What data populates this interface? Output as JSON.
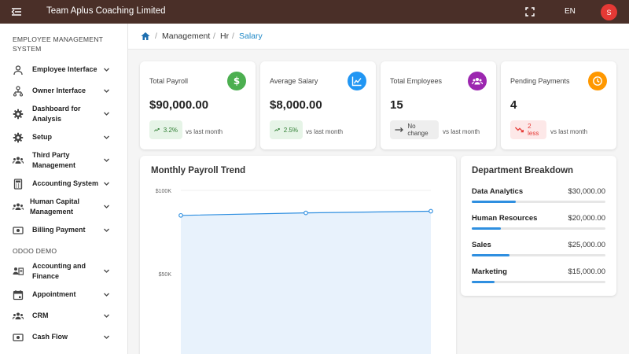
{
  "app": {
    "title": "Team Aplus Coaching Limited",
    "language": "EN",
    "avatar_initial": "S"
  },
  "sidebar": {
    "sections": [
      {
        "title": "EMPLOYEE MANAGEMENT SYSTEM",
        "items": [
          {
            "label": "Employee Interface",
            "icon": "person-icon"
          },
          {
            "label": "Owner Interface",
            "icon": "org-tree-icon"
          },
          {
            "label": "Dashboard for Analysis",
            "icon": "gear-icon"
          },
          {
            "label": "Setup",
            "icon": "gear-icon"
          },
          {
            "label": "Third Party Management",
            "icon": "group-icon"
          },
          {
            "label": "Accounting System",
            "icon": "calculator-icon"
          },
          {
            "label": "Human Capital Management",
            "icon": "group-icon"
          },
          {
            "label": "Billing Payment",
            "icon": "payment-icon"
          }
        ]
      },
      {
        "title": "ODOO DEMO",
        "items": [
          {
            "label": "Accounting and Finance",
            "icon": "finance-icon"
          },
          {
            "label": "Appointment",
            "icon": "calendar-icon"
          },
          {
            "label": "CRM",
            "icon": "group-icon"
          },
          {
            "label": "Cash Flow",
            "icon": "payment-icon"
          }
        ]
      }
    ]
  },
  "breadcrumb": {
    "items": [
      "Management",
      "Hr",
      "Salary"
    ]
  },
  "stats": [
    {
      "label": "Total Payroll",
      "value": "$90,000.00",
      "icon": "dollar-icon",
      "color": "#4caf50",
      "trend": "3.2%",
      "trend_dir": "up",
      "note": "vs last month"
    },
    {
      "label": "Average Salary",
      "value": "$8,000.00",
      "icon": "chart-line-icon",
      "color": "#2196f3",
      "trend": "2.5%",
      "trend_dir": "up",
      "note": "vs last month"
    },
    {
      "label": "Total Employees",
      "value": "15",
      "icon": "people-icon",
      "color": "#9c27b0",
      "trend": "No change",
      "trend_dir": "flat",
      "note": "vs last month"
    },
    {
      "label": "Pending Payments",
      "value": "4",
      "icon": "clock-icon",
      "color": "#ff9800",
      "trend": "2 less",
      "trend_dir": "down",
      "note": "vs last month"
    }
  ],
  "payroll_trend": {
    "title": "Monthly Payroll Trend",
    "chart_data": {
      "type": "area",
      "title": "Monthly Payroll Trend",
      "yticks": [
        "$100K",
        "$50K"
      ],
      "ylim": [
        0,
        100000
      ],
      "values": [
        85000,
        86500,
        87500
      ],
      "grid": true
    }
  },
  "departments": {
    "title": "Department Breakdown",
    "items": [
      {
        "name": "Data Analytics",
        "amount": "$30,000.00",
        "share": 0.33
      },
      {
        "name": "Human Resources",
        "amount": "$20,000.00",
        "share": 0.22
      },
      {
        "name": "Sales",
        "amount": "$25,000.00",
        "share": 0.28
      },
      {
        "name": "Marketing",
        "amount": "$15,000.00",
        "share": 0.17
      }
    ]
  },
  "colors": {
    "topbar": "#4a2f28",
    "accent": "#1e88c7",
    "area_fill": "#e8f2fc",
    "line": "#2f8fe0"
  }
}
